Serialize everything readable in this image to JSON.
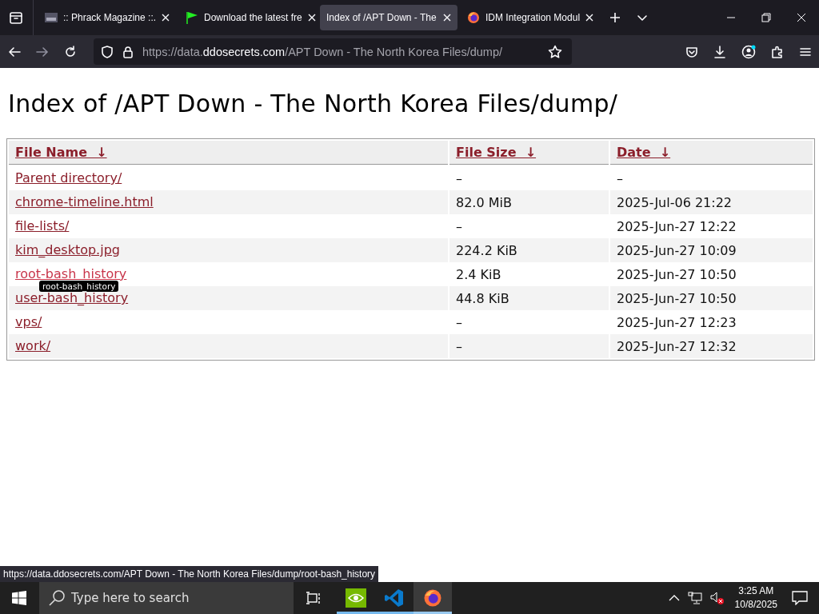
{
  "browser": {
    "tabs": [
      {
        "label": ":: Phrack Magazine ::.",
        "selected": false
      },
      {
        "label": "Download the latest fre",
        "selected": false
      },
      {
        "label": "Index of /APT Down - The",
        "selected": true
      },
      {
        "label": "IDM Integration Modul",
        "selected": false
      }
    ],
    "url": {
      "prefix": "https://data.",
      "domain": "ddosecrets.com",
      "path": "/APT Down - The North Korea Files/dump/"
    }
  },
  "page": {
    "title": "Index of /APT Down - The North Korea Files/dump/",
    "columns": [
      {
        "label": "File Name",
        "sort": "↓"
      },
      {
        "label": "File Size",
        "sort": "↓"
      },
      {
        "label": "Date",
        "sort": "↓"
      }
    ],
    "rows": [
      {
        "name": "Parent directory/",
        "size": "–",
        "date": "–",
        "hovered": false
      },
      {
        "name": "chrome-timeline.html",
        "size": "82.0 MiB",
        "date": "2025-Jul-06 21:22",
        "hovered": false
      },
      {
        "name": "file-lists/",
        "size": "–",
        "date": "2025-Jun-27 12:22",
        "hovered": false
      },
      {
        "name": "kim_desktop.jpg",
        "size": "224.2 KiB",
        "date": "2025-Jun-27 10:09",
        "hovered": false
      },
      {
        "name": "root-bash_history",
        "size": "2.4 KiB",
        "date": "2025-Jun-27 10:50",
        "hovered": true
      },
      {
        "name": "user-bash_history",
        "size": "44.8 KiB",
        "date": "2025-Jun-27 10:50",
        "hovered": false
      },
      {
        "name": "vps/",
        "size": "–",
        "date": "2025-Jun-27 12:23",
        "hovered": false
      },
      {
        "name": "work/",
        "size": "–",
        "date": "2025-Jun-27 12:32",
        "hovered": false
      }
    ],
    "tooltip": "root-bash_history"
  },
  "status_link": "https://data.ddosecrets.com/APT Down - The North Korea Files/dump/root-bash_history",
  "taskbar": {
    "search": {
      "placeholder": "Type here to search"
    },
    "apps": [
      {
        "kind": "nvidia",
        "selected": false
      },
      {
        "kind": "vscode",
        "selected": false
      },
      {
        "kind": "firefox",
        "selected": true
      }
    ],
    "time": "3:25 AM",
    "date": "10/8/2025"
  }
}
